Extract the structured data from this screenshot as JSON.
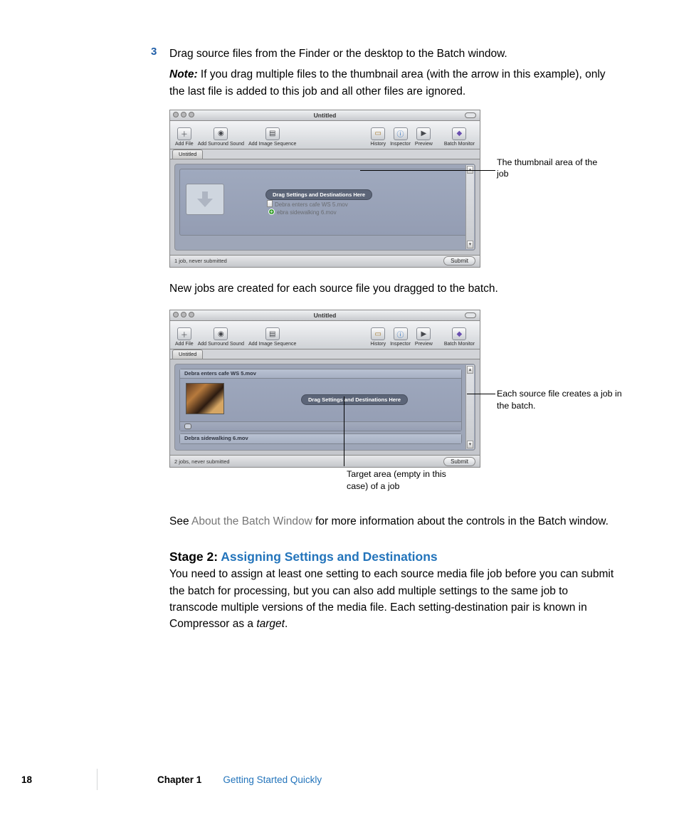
{
  "step": {
    "number": "3",
    "text": "Drag source files from the Finder or the desktop to the Batch window.",
    "note_label": "Note:",
    "note_text": "  If you drag multiple files to the thumbnail area (with the arrow in this example), only the last file is added to this job and all other files are ignored."
  },
  "window1": {
    "title": "Untitled",
    "toolbar_left": [
      {
        "icon": "＋",
        "label": "Add File"
      },
      {
        "icon": "◎",
        "label": "Add Surround Sound"
      },
      {
        "icon": "▤",
        "label": "Add Image Sequence"
      }
    ],
    "toolbar_right": [
      {
        "icon": "▣",
        "label": "History",
        "tint": "#c99b3d"
      },
      {
        "icon": "ⓘ",
        "label": "Inspector",
        "tint": "#3a7bc8"
      },
      {
        "icon": "▶",
        "label": "Preview",
        "tint": "#555"
      },
      {
        "icon": "◇",
        "label": "Batch Monitor",
        "tint": "#7b5fc4"
      }
    ],
    "tab": "Untitled",
    "drop_pill": "Drag Settings and Destinations Here",
    "drag_file_1": "Debra enters cafe WS 5.mov",
    "drag_file_2": "ebra sidewalking 6.mov",
    "status": "1 job, never submitted",
    "submit": "Submit"
  },
  "callout1": "The thumbnail area of the job",
  "mid_para": "New jobs are created for each source file you dragged to the batch.",
  "window2": {
    "title": "Untitled",
    "tab": "Untitled",
    "job1_title": "Debra enters cafe WS 5.mov",
    "drop_pill": "Drag Settings and Destinations Here",
    "job2_title": "Debra sidewalking 6.mov",
    "status": "2 jobs, never submitted",
    "submit": "Submit"
  },
  "callout2": "Each source file creates a job in the batch.",
  "callout3": "Target area (empty in this case) of a job",
  "see_para_lead": "See ",
  "see_para_link": "About the Batch Window",
  "see_para_tail": " for more information about the controls in the Batch window.",
  "stage": {
    "prefix": "Stage 2: ",
    "title": "Assigning Settings and Destinations",
    "body": "You need to assign at least one setting to each source media file job before you can submit the batch for processing, but you can also add multiple settings to the same job to transcode multiple versions of the media file. Each setting-destination pair is known in Compressor as a ",
    "em": "target",
    "period": "."
  },
  "footer": {
    "page": "18",
    "chapter": "Chapter 1",
    "title": "Getting Started Quickly"
  }
}
